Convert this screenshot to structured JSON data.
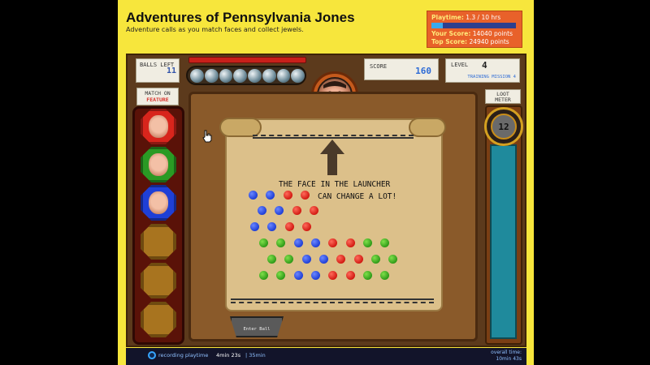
{
  "header": {
    "title": "Adventures of Pennsylvania Jones",
    "subtitle": "Adventure calls as you match faces and collect jewels."
  },
  "stats": {
    "playtime_label": "Playtime:",
    "playtime_value": "1.3 / 10 hrs",
    "playtime_progress": 0.13,
    "your_score_label": "Your Score:",
    "your_score_value": "14040 points",
    "top_score_label": "Top Score:",
    "top_score_value": "24940 points"
  },
  "hud": {
    "balls_left_label": "Balls Left",
    "balls_left_value": "11",
    "score_label": "Score",
    "score_value": "160",
    "level_label": "Level",
    "level_value": "4",
    "level_mission": "Training Mission 4",
    "match_label_1": "Match on",
    "match_label_2": "Feature",
    "loot_label": "Loot Meter",
    "loot_value": "12"
  },
  "hint": {
    "line1": "The face in the launcher",
    "line2": "can change a lot!"
  },
  "cart": {
    "label": "Enter Ball"
  },
  "faces": [
    {
      "color": "#d8251c"
    },
    {
      "color": "#2a9a24"
    },
    {
      "color": "#1f3fd6"
    }
  ],
  "statusbar": {
    "recording_label": "recording playtime",
    "time": "4min 23s",
    "time_left": "| 35min",
    "overall_label": "overall time:",
    "overall_value": "10min 43s"
  }
}
